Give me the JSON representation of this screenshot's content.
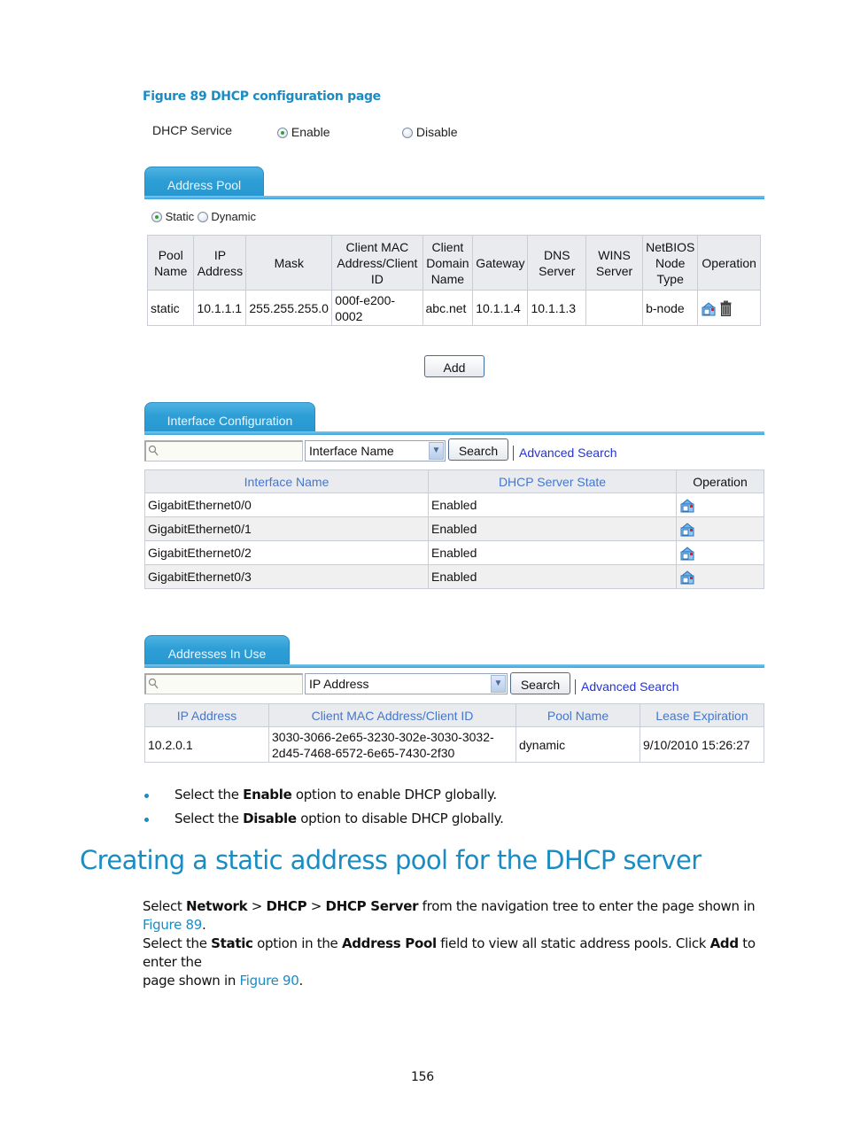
{
  "figure_caption": "Figure 89 DHCP configuration page",
  "dhcp_service": {
    "label": "DHCP Service",
    "options": [
      {
        "label": "Enable",
        "selected": true
      },
      {
        "label": "Disable",
        "selected": false
      }
    ]
  },
  "address_pool": {
    "tab_label": "Address Pool",
    "mode_options": [
      {
        "label": "Static",
        "selected": true
      },
      {
        "label": "Dynamic",
        "selected": false
      }
    ],
    "columns": [
      "Pool Name",
      "IP Address",
      "Mask",
      "Client MAC Address/Client ID",
      "Client Domain Name",
      "Gateway",
      "DNS Server",
      "WINS Server",
      "NetBIOS Node Type",
      "Operation"
    ],
    "column_lines": [
      [
        "Pool",
        "Name"
      ],
      [
        "IP",
        "Address"
      ],
      [
        "Mask"
      ],
      [
        "Client MAC",
        "Address/Client",
        "ID"
      ],
      [
        "Client",
        "Domain",
        "Name"
      ],
      [
        "Gateway"
      ],
      [
        "DNS",
        "Server"
      ],
      [
        "WINS",
        "Server"
      ],
      [
        "NetBIOS",
        "Node",
        "Type"
      ],
      [
        "Operation"
      ]
    ],
    "rows": [
      {
        "pool_name": "static",
        "ip_address": "10.1.1.1",
        "mask": "255.255.255.0",
        "client_id": "000f-e200-0002",
        "client_id_lines": [
          "000f-e200-",
          "0002"
        ],
        "domain_name": "abc.net",
        "gateway": "10.1.1.4",
        "dns_server": "10.1.1.3",
        "wins_server": "",
        "netbios_type": "b-node",
        "operations": [
          "edit-icon",
          "delete-icon"
        ]
      }
    ],
    "add_button": "Add"
  },
  "interface_config": {
    "tab_label": "Interface Configuration",
    "search": {
      "placeholder": "",
      "field_selected": "Interface Name",
      "button": "Search",
      "advanced_link": "Advanced Search"
    },
    "columns": [
      "Interface Name",
      "DHCP Server State",
      "Operation"
    ],
    "rows": [
      {
        "interface": "GigabitEthernet0/0",
        "state": "Enabled",
        "operation": "edit-icon"
      },
      {
        "interface": "GigabitEthernet0/1",
        "state": "Enabled",
        "operation": "edit-icon"
      },
      {
        "interface": "GigabitEthernet0/2",
        "state": "Enabled",
        "operation": "edit-icon"
      },
      {
        "interface": "GigabitEthernet0/3",
        "state": "Enabled",
        "operation": "edit-icon"
      }
    ]
  },
  "addresses_in_use": {
    "tab_label": "Addresses In Use",
    "search": {
      "placeholder": "",
      "field_selected": "IP Address",
      "button": "Search",
      "advanced_link": "Advanced Search"
    },
    "columns": [
      "IP Address",
      "Client MAC Address/Client ID",
      "Pool Name",
      "Lease Expiration"
    ],
    "rows": [
      {
        "ip": "10.2.0.1",
        "client_id": "3030-3066-2e65-3230-302e-3030-3032-2d45-7468-6572-6e65-7430-2f30",
        "client_id_lines": [
          "3030-3066-2e65-3230-302e-3030-3032-",
          "2d45-7468-6572-6e65-7430-2f30"
        ],
        "pool": "dynamic",
        "lease": "9/10/2010 15:26:27"
      }
    ]
  },
  "bullets": [
    {
      "pre": "Select the ",
      "bold": "Enable",
      "post": " option to enable DHCP globally."
    },
    {
      "pre": "Select the ",
      "bold": "Disable",
      "post": " option to disable DHCP globally."
    }
  ],
  "section_heading": "Creating a static address pool for the DHCP server",
  "paragraph": {
    "l1": {
      "t1": "Select ",
      "b1": "Network",
      "t2": " > ",
      "b2": "DHCP",
      "t3": " > ",
      "b3": "DHCP Server",
      "t4": " from the navigation tree to enter the page shown in ",
      "x1": "Figure 89",
      "t5": "."
    },
    "l2": {
      "t1": "Select the ",
      "b1": "Static",
      "t2": " option in the ",
      "b2": "Address Pool",
      "t3": " field to view all static address pools. Click ",
      "b3": "Add",
      "t4": " to enter the"
    },
    "l3": {
      "t1": "page shown in ",
      "x1": "Figure 90",
      "t2": "."
    }
  },
  "page_number": "156",
  "colors": {
    "accent": "#1a8cc4",
    "tab": "#2e9fd6",
    "link": "#2233dd",
    "header_link": "#4477cc"
  }
}
